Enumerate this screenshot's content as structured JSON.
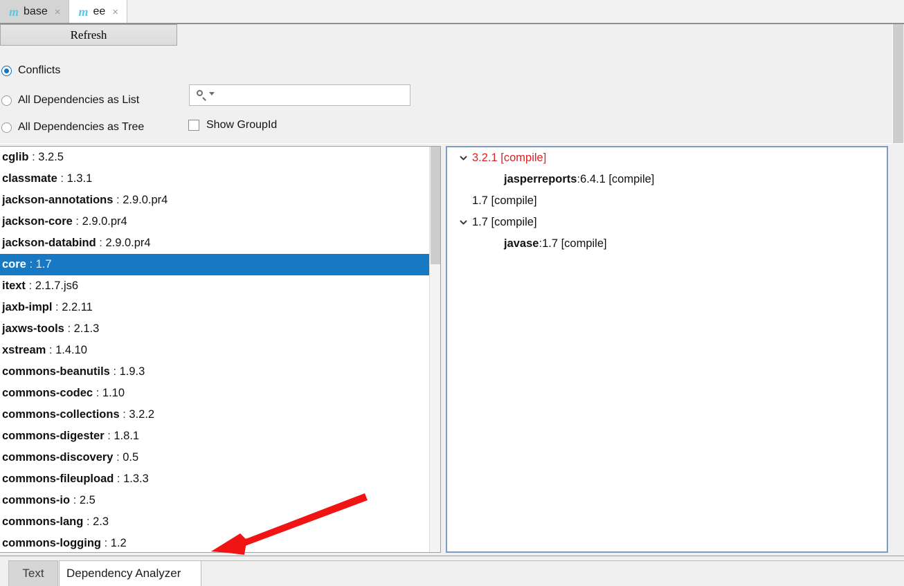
{
  "editor_tabs": [
    {
      "icon": "maven-icon",
      "label": "base",
      "close": "×",
      "active": false
    },
    {
      "icon": "maven-icon",
      "label": "ee",
      "close": "×",
      "active": true
    }
  ],
  "toolbar": {
    "refresh_label": "Refresh"
  },
  "options": {
    "radios": [
      {
        "label": "Conflicts",
        "checked": true
      },
      {
        "label": "All Dependencies as List",
        "checked": false
      },
      {
        "label": "All Dependencies as Tree",
        "checked": false
      }
    ],
    "search": {
      "value": "",
      "placeholder": "",
      "icon": "search-icon"
    },
    "show_groupid": {
      "label": "Show GroupId",
      "checked": false
    }
  },
  "dependency_list": {
    "selected_index": 5,
    "items": [
      {
        "artifact": "cglib",
        "sep": " : ",
        "version": "3.2.5"
      },
      {
        "artifact": "classmate",
        "sep": " : ",
        "version": "1.3.1"
      },
      {
        "artifact": "jackson-annotations",
        "sep": " : ",
        "version": "2.9.0.pr4"
      },
      {
        "artifact": "jackson-core",
        "sep": " : ",
        "version": "2.9.0.pr4"
      },
      {
        "artifact": "jackson-databind",
        "sep": " : ",
        "version": "2.9.0.pr4"
      },
      {
        "artifact": "core",
        "sep": " : ",
        "version": "1.7"
      },
      {
        "artifact": "itext",
        "sep": " : ",
        "version": "2.1.7.js6"
      },
      {
        "artifact": "jaxb-impl",
        "sep": " : ",
        "version": "2.2.11"
      },
      {
        "artifact": "jaxws-tools",
        "sep": " : ",
        "version": "2.1.3"
      },
      {
        "artifact": "xstream",
        "sep": " : ",
        "version": "1.4.10"
      },
      {
        "artifact": "commons-beanutils",
        "sep": " : ",
        "version": "1.9.3"
      },
      {
        "artifact": "commons-codec",
        "sep": " : ",
        "version": "1.10"
      },
      {
        "artifact": "commons-collections",
        "sep": " : ",
        "version": "3.2.2"
      },
      {
        "artifact": "commons-digester",
        "sep": " : ",
        "version": "1.8.1"
      },
      {
        "artifact": "commons-discovery",
        "sep": " : ",
        "version": "0.5"
      },
      {
        "artifact": "commons-fileupload",
        "sep": " : ",
        "version": "1.3.3"
      },
      {
        "artifact": "commons-io",
        "sep": " : ",
        "version": "2.5"
      },
      {
        "artifact": "commons-lang",
        "sep": " : ",
        "version": "2.3"
      },
      {
        "artifact": "commons-logging",
        "sep": " : ",
        "version": "1.2"
      }
    ]
  },
  "dependency_tree": {
    "rows": [
      {
        "indent": 0,
        "toggle": "chevron-down-icon",
        "artifact": "",
        "sep": "",
        "text": "3.2.1 [compile]",
        "conflict": true
      },
      {
        "indent": 1,
        "toggle": "none",
        "artifact": "jasperreports",
        "sep": " : ",
        "text": "6.4.1 [compile]",
        "conflict": false
      },
      {
        "indent": 0,
        "toggle": "none",
        "artifact": "",
        "sep": "",
        "text": "1.7 [compile]",
        "conflict": false
      },
      {
        "indent": 0,
        "toggle": "chevron-down-icon",
        "artifact": "",
        "sep": "",
        "text": "1.7 [compile]",
        "conflict": false
      },
      {
        "indent": 1,
        "toggle": "none",
        "artifact": "javase",
        "sep": " : ",
        "text": "1.7 [compile]",
        "conflict": false
      }
    ]
  },
  "bottom_tabs": [
    {
      "label": "Text",
      "active": false
    },
    {
      "label": "Dependency Analyzer",
      "active": true
    }
  ],
  "annotation": {
    "shape": "red-arrow",
    "color": "#f01414"
  },
  "colors": {
    "selection": "#1779c4",
    "conflict_text": "#e02020",
    "accent": "#0f76c8",
    "maven_icon": "#5cc6e8"
  }
}
